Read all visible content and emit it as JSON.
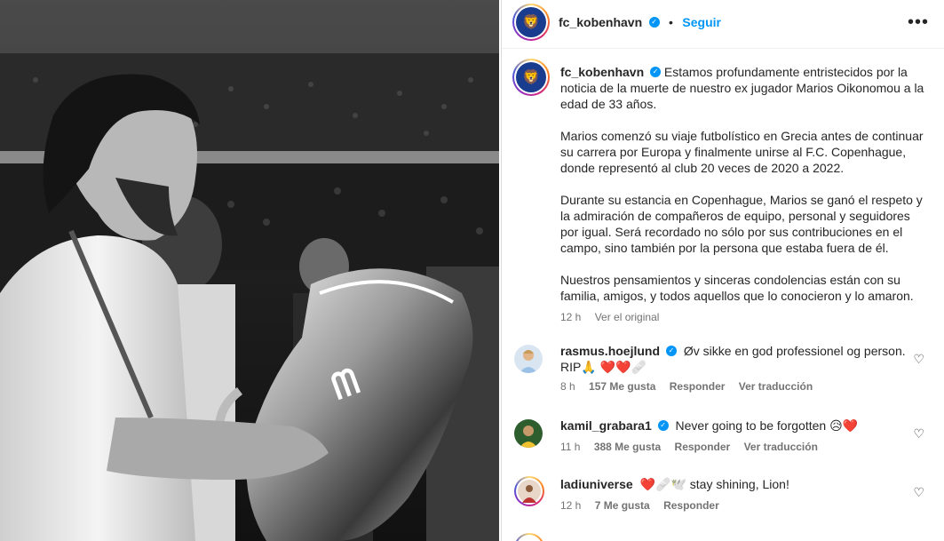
{
  "post": {
    "username": "fc_kobenhavn",
    "follow_label": "Seguir",
    "dot": "•",
    "more_icon": "•••",
    "caption_paragraphs": [
      "Estamos profundamente entristecidos por la noticia de la muerte de nuestro ex jugador Marios Oikonomou a la edad de 33 años.",
      "Marios comenzó su viaje futbolístico en Grecia antes de continuar su carrera por Europa y finalmente unirse al F.C. Copenhague, donde representó al club 20 veces de 2020 a 2022.",
      "Durante su estancia en Copenhague, Marios se ganó el respeto y la admiración de compañeros de equipo, personal y seguidores por igual. Será recordado no sólo por sus contribuciones en el campo, sino también por la persona que estaba fuera de él.",
      "Nuestros pensamientos y sinceras condolencias están con su familia, amigos, y todos aquellos que lo conocieron y lo amaron."
    ],
    "caption_time": "12 h",
    "see_original": "Ver el original"
  },
  "comments": [
    {
      "username": "rasmus.hoejlund",
      "verified": true,
      "text": "Øv sikke en god professionel og person. RIP🙏 ❤️❤️🩹",
      "time": "8 h",
      "likes": "157 Me gusta",
      "reply": "Responder",
      "translate": "Ver traducción"
    },
    {
      "username": "kamil_grabara1",
      "verified": true,
      "text": "Never going to be forgotten 😥❤️",
      "time": "11 h",
      "likes": "388 Me gusta",
      "reply": "Responder",
      "translate": "Ver traducción"
    },
    {
      "username": "ladiuniverse",
      "verified": false,
      "text": "❤️🩹🕊️ stay shining, Lion!",
      "time": "12 h",
      "likes": "7 Me gusta",
      "reply": "Responder",
      "translate": ""
    }
  ],
  "icons": {
    "heart": "♡",
    "verified": "✓"
  },
  "colors": {
    "link_blue": "#0095f6",
    "meta_gray": "#737373",
    "club_blue": "#1a3c8f"
  }
}
